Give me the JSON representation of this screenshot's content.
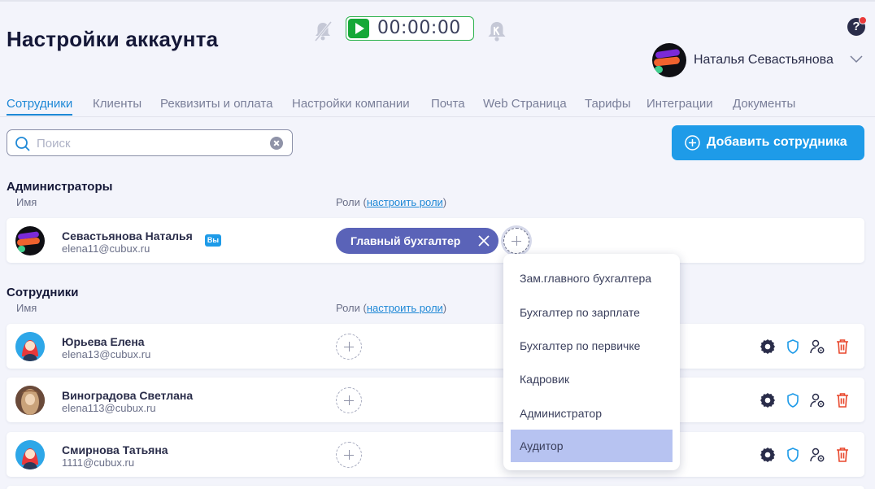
{
  "header": {
    "title": "Настройки аккаунта",
    "timer": "00:00:00",
    "help": "?",
    "user_name": "Наталья Севастьянова"
  },
  "tabs": [
    {
      "label": "Сотрудники",
      "active": true
    },
    {
      "label": "Клиенты"
    },
    {
      "label": "Реквизиты и оплата"
    },
    {
      "label": "Настройки компании"
    },
    {
      "label": "Почта"
    },
    {
      "label": "Web Страница"
    },
    {
      "label": "Тарифы"
    },
    {
      "label": "Интеграции"
    },
    {
      "label": "Документы"
    }
  ],
  "search": {
    "placeholder": "Поиск",
    "value": ""
  },
  "add_button": "Добавить сотрудника",
  "admins": {
    "title": "Администраторы",
    "col_name": "Имя",
    "col_roles": "Роли (",
    "col_roles_link": "настроить роли",
    "col_roles_end": ")",
    "rows": [
      {
        "name": "Севастьянова Наталья",
        "email": "elena11@cubux.ru",
        "badge": "Вы",
        "role": "Главный бухгалтер"
      }
    ]
  },
  "employees": {
    "title": "Сотрудники",
    "col_name": "Имя",
    "col_roles": "Роли (",
    "col_roles_link": "настроить роли",
    "col_roles_end": ")",
    "rows": [
      {
        "name": "Юрьева Елена",
        "email": "elena13@cubux.ru"
      },
      {
        "name": "Виноградова Светлана",
        "email": "elena113@cubux.ru"
      },
      {
        "name": "Смирнова Татьяна",
        "email": "1111@cubux.ru"
      }
    ]
  },
  "role_menu": {
    "items": [
      "Зам.главного бухгалтера",
      "Бухгалтер по зарплате",
      "Бухгалтер по первичке",
      "Кадровик",
      "Администратор",
      "Аудитор"
    ],
    "highlighted": "Аудитор"
  },
  "colors": {
    "accent": "#1e9be8",
    "role_chip": "#5a63b8",
    "timer_green": "#16a838",
    "delete_red": "#e8462b"
  }
}
